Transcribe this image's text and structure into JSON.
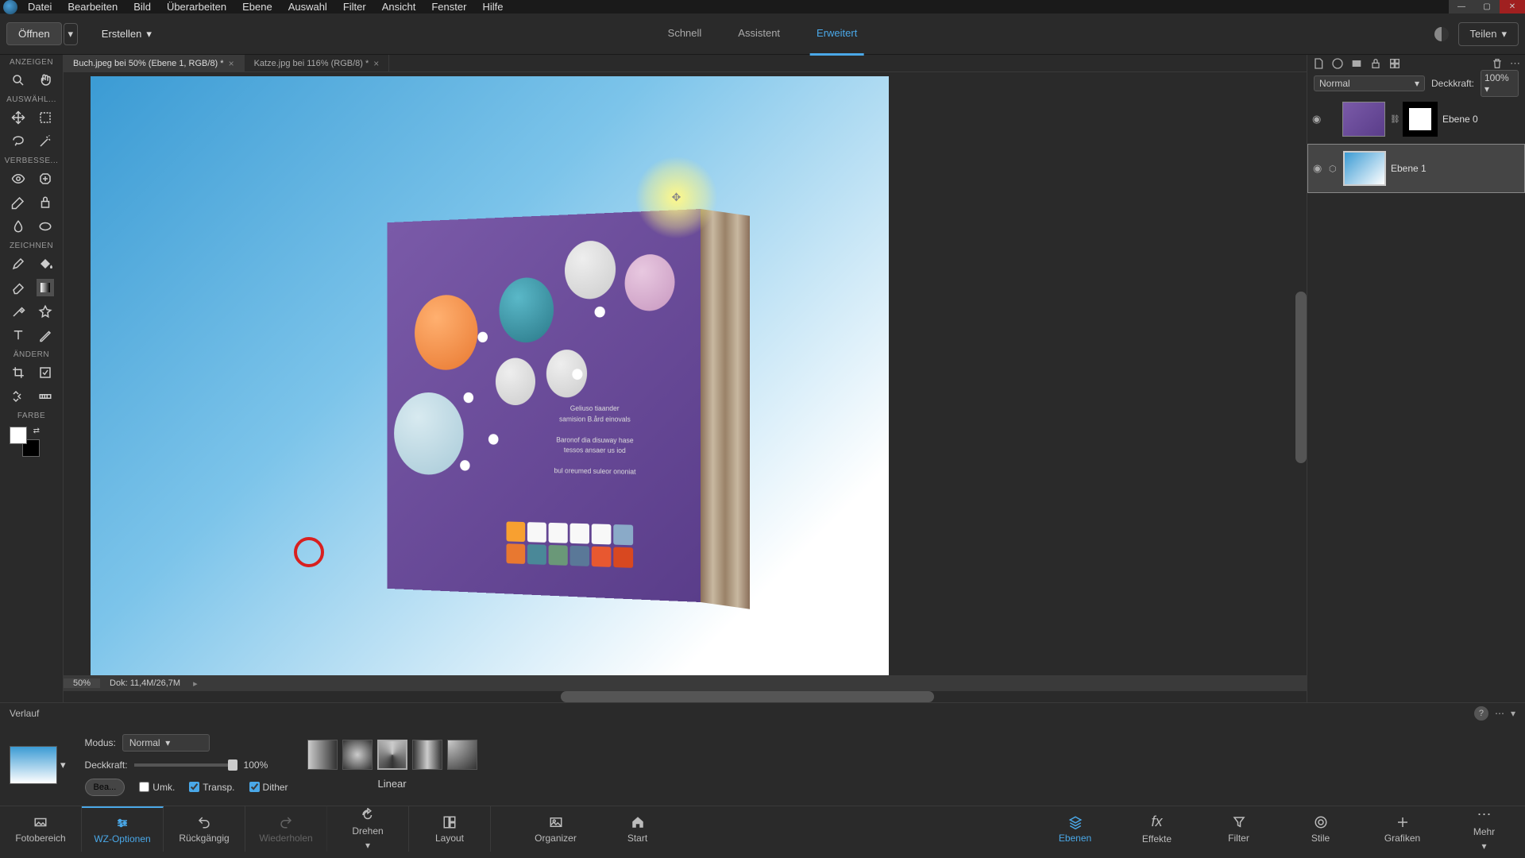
{
  "menubar": [
    "Datei",
    "Bearbeiten",
    "Bild",
    "Überarbeiten",
    "Ebene",
    "Auswahl",
    "Filter",
    "Ansicht",
    "Fenster",
    "Hilfe"
  ],
  "secbar": {
    "open": "Öffnen",
    "create": "Erstellen",
    "share": "Teilen"
  },
  "modes": {
    "quick": "Schnell",
    "guided": "Assistent",
    "expert": "Erweitert"
  },
  "doctabs": [
    {
      "label": "Buch.jpeg bei 50% (Ebene 1, RGB/8) *"
    },
    {
      "label": "Katze.jpg bei 116% (RGB/8) *"
    }
  ],
  "status": {
    "zoom": "50%",
    "docinfo": "Dok: 11,4M/26,7M"
  },
  "tool_sections": {
    "view": "ANZEIGEN",
    "select": "AUSWÄHL...",
    "enhance": "VERBESSE...",
    "draw": "ZEICHNEN",
    "modify": "ÄNDERN",
    "color": "FARBE"
  },
  "layers": {
    "blend_label": "",
    "blend_value": "Normal",
    "opacity_label": "Deckkraft:",
    "opacity_value": "100%",
    "items": [
      {
        "name": "Ebene 0"
      },
      {
        "name": "Ebene 1"
      }
    ]
  },
  "options": {
    "title": "Verlauf",
    "mode_label": "Modus:",
    "mode_value": "Normal",
    "opacity_label": "Deckkraft:",
    "opacity_value": "100%",
    "type_label": "Linear",
    "edit": "Bea...",
    "reverse": "Umk.",
    "transp": "Transp.",
    "dither": "Dither"
  },
  "taskbar": {
    "left": [
      "Fotobereich",
      "WZ-Optionen",
      "Rückgängig",
      "Wiederholen",
      "Drehen",
      "Layout",
      "Organizer",
      "Start"
    ],
    "right": [
      "Ebenen",
      "Effekte",
      "Filter",
      "Stile",
      "Grafiken",
      "Mehr"
    ]
  }
}
